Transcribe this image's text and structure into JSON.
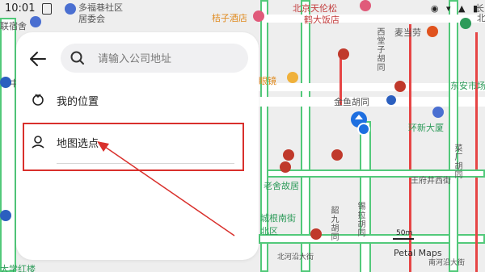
{
  "status_bar": {
    "time": "10:01",
    "icons": "◉ ▾ ▲ ▮"
  },
  "map": {
    "labels": {
      "l1": "多福巷社区",
      "l2": "居委会",
      "l3": "联宿舍",
      "l4": "桔子酒店",
      "l5": "北京天伦松",
      "l6": "鹤大饭店",
      "l7": "麦当劳",
      "l8": "西堂子胡同",
      "l9": "金鱼胡同",
      "l10": "东安市场",
      "l11": "环新大厦",
      "l12": "菜厂胡同",
      "l13": "王府井西街",
      "l14": "老舍故居",
      "l15": "城根南街",
      "l16": "北区",
      "l17": "韶九胡同",
      "l18": "锡拉胡同",
      "l19": "北河沿大街",
      "l20": "南河沿大街",
      "l21": "大学红楼",
      "l22": "眼镜",
      "l23": "中",
      "l24": "北",
      "l25": "长"
    },
    "scale": "50m",
    "attribution": "Petal Maps"
  },
  "panel": {
    "search_placeholder": "请输入公司地址",
    "option_my_location": "我的位置",
    "option_map_pick": "地图选点"
  },
  "colors": {
    "highlight": "#d9302c",
    "road_green": "#52c97a",
    "road_red": "#e64545",
    "location_blue": "#1e6fe0"
  }
}
